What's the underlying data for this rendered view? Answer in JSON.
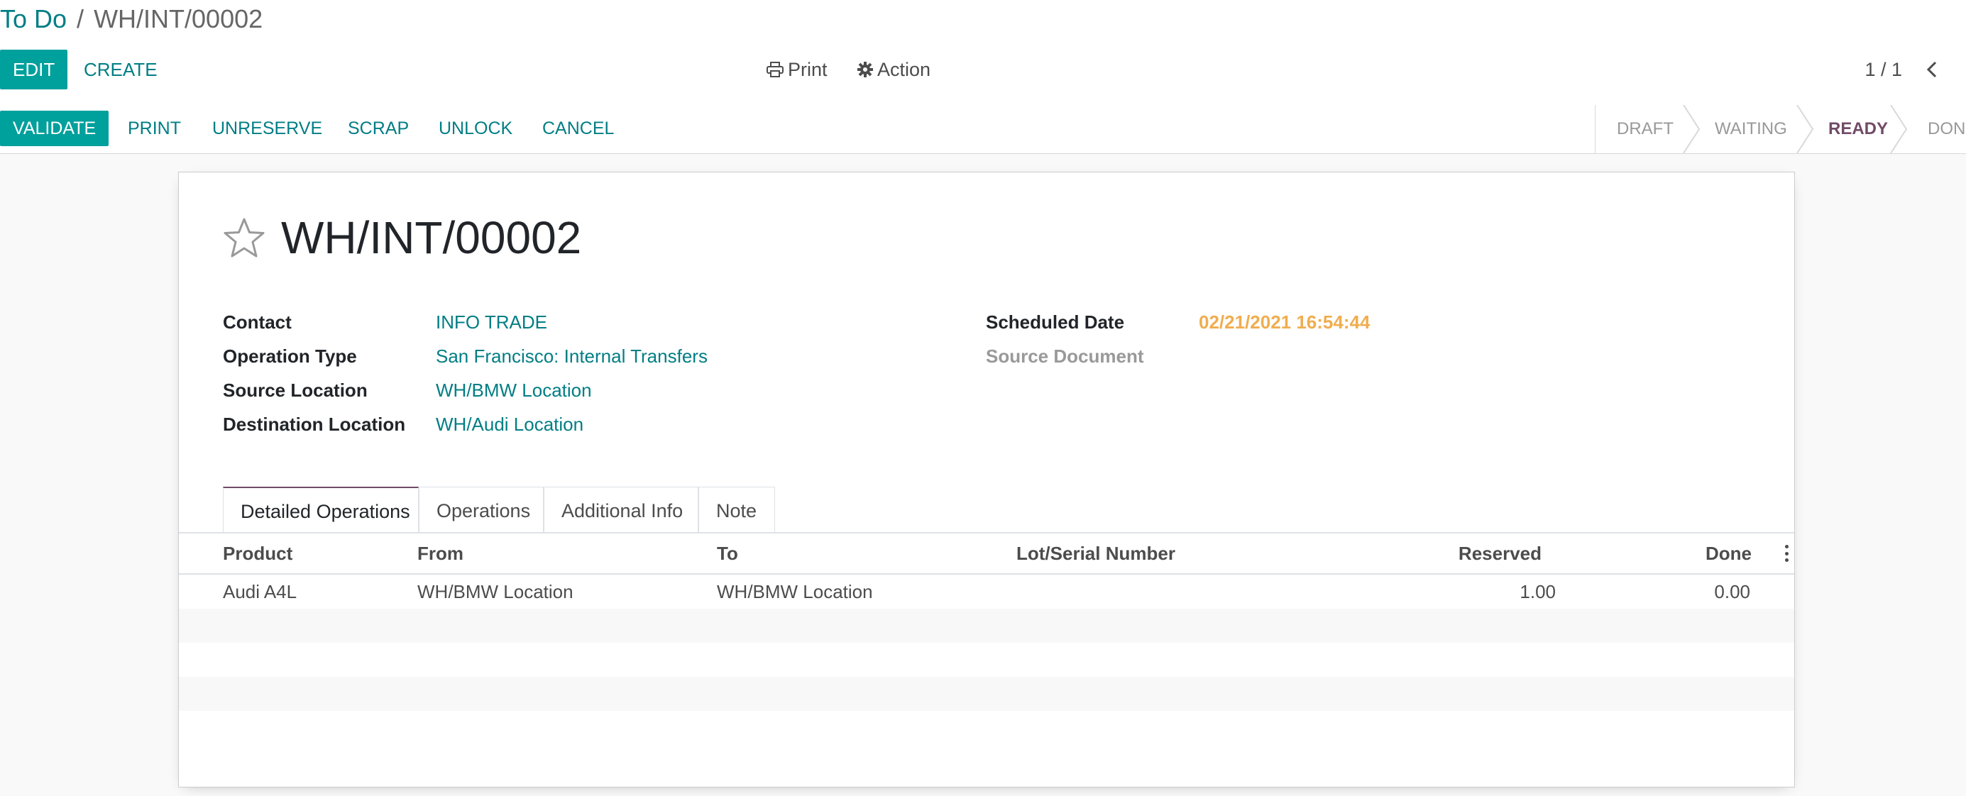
{
  "breadcrumb": {
    "parent": "To Do",
    "separator": "/",
    "current": "WH/INT/00002"
  },
  "toolbar": {
    "edit_label": "EDIT",
    "create_label": "CREATE",
    "print_label": "Print",
    "action_label": "Action"
  },
  "pager": {
    "value": "1 / 1"
  },
  "statusbar": {
    "buttons": {
      "validate": "VALIDATE",
      "print": "PRINT",
      "unreserve": "UNRESERVE",
      "scrap": "SCRAP",
      "unlock": "UNLOCK",
      "cancel": "CANCEL"
    },
    "stages": {
      "draft": "DRAFT",
      "waiting": "WAITING",
      "ready": "READY",
      "done": "DON"
    },
    "active_stage": "READY"
  },
  "record": {
    "title": "WH/INT/00002",
    "fields": {
      "contact_label": "Contact",
      "contact_value": "INFO TRADE",
      "operation_type_label": "Operation Type",
      "operation_type_value": "San Francisco: Internal Transfers",
      "source_location_label": "Source Location",
      "source_location_value": "WH/BMW Location",
      "destination_location_label": "Destination Location",
      "destination_location_value": "WH/Audi Location",
      "scheduled_date_label": "Scheduled Date",
      "scheduled_date_value": "02/21/2021 16:54:44",
      "source_document_label": "Source Document"
    }
  },
  "tabs": {
    "detailed": "Detailed Operations",
    "operations": "Operations",
    "additional": "Additional Info",
    "note": "Note"
  },
  "table": {
    "headers": {
      "product": "Product",
      "from": "From",
      "to": "To",
      "lot": "Lot/Serial Number",
      "reserved": "Reserved",
      "done": "Done"
    },
    "rows": [
      {
        "product": "Audi A4L",
        "from": "WH/BMW Location",
        "to": "WH/BMW Location",
        "lot": "",
        "reserved": "1.00",
        "done": "0.00"
      }
    ]
  },
  "colors": {
    "accent": "#00a09d",
    "link": "#017e84",
    "stage_active": "#714b67",
    "date": "#f0ad4e"
  }
}
